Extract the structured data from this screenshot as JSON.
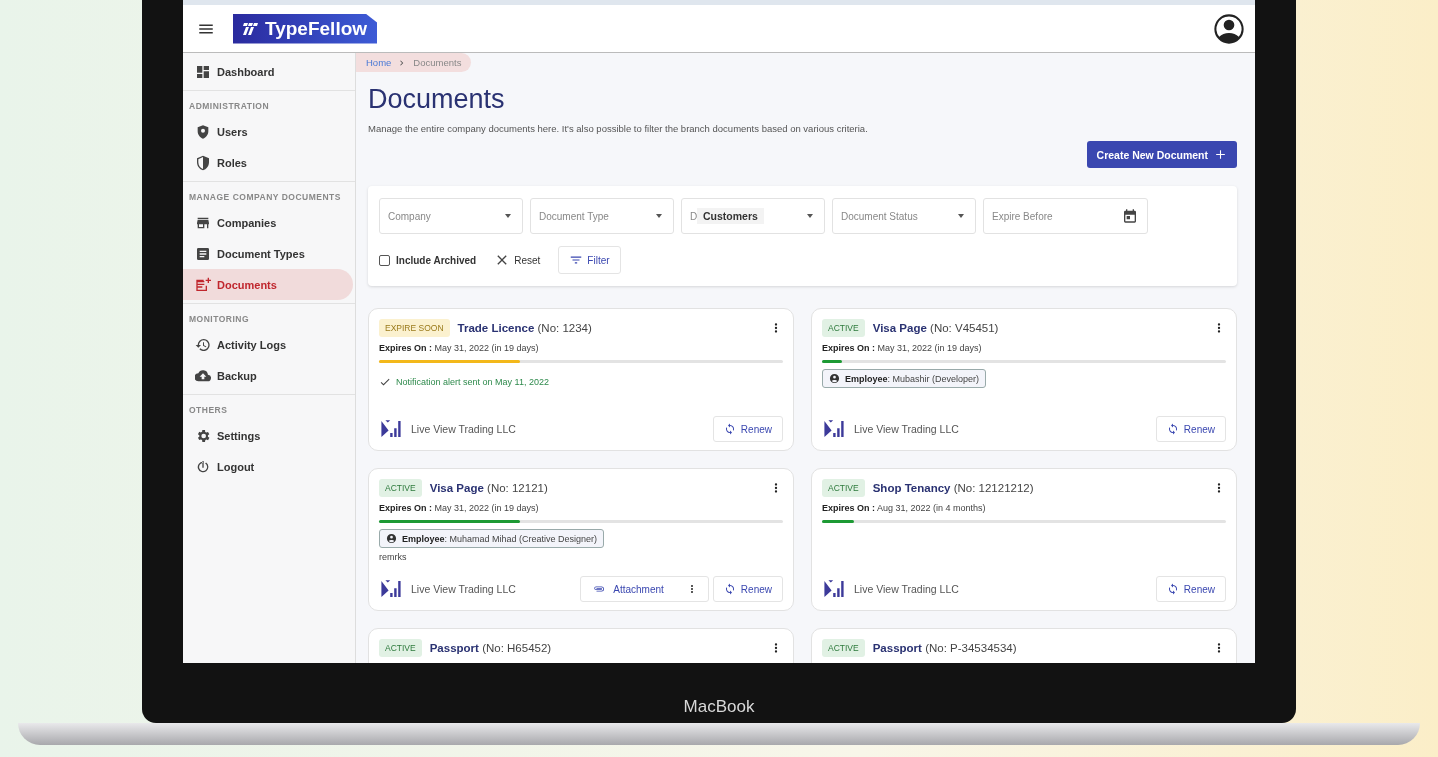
{
  "device_label": "MacBook",
  "app_bar": {
    "brand": "TypeFellow"
  },
  "sidebar": {
    "items": [
      {
        "kind": "item",
        "label": "Dashboard",
        "selected": false
      },
      {
        "kind": "header",
        "label": "ADMINISTRATION"
      },
      {
        "kind": "item",
        "label": "Users",
        "selected": false
      },
      {
        "kind": "item",
        "label": "Roles",
        "selected": false
      },
      {
        "kind": "header",
        "label": "MANAGE COMPANY DOCUMENTS"
      },
      {
        "kind": "item",
        "label": "Companies",
        "selected": false
      },
      {
        "kind": "item",
        "label": "Document Types",
        "selected": false
      },
      {
        "kind": "item",
        "label": "Documents",
        "selected": true
      },
      {
        "kind": "header",
        "label": "MONITORING"
      },
      {
        "kind": "item",
        "label": "Activity Logs",
        "selected": false
      },
      {
        "kind": "item",
        "label": "Backup",
        "selected": false
      },
      {
        "kind": "header",
        "label": "OTHERS"
      },
      {
        "kind": "item",
        "label": "Settings",
        "selected": false
      },
      {
        "kind": "item",
        "label": "Logout",
        "selected": false
      }
    ]
  },
  "breadcrumb": [
    "Home",
    "Documents"
  ],
  "page": {
    "title": "Documents",
    "description": "Manage the entire company documents here. It's also possible to filter the branch documents based on various criteria.",
    "create_button": "Create New Document"
  },
  "filters": {
    "fields": [
      {
        "kind": "select",
        "placeholder": "Company"
      },
      {
        "kind": "select",
        "placeholder": "Document Type"
      },
      {
        "kind": "select",
        "placeholder": "D",
        "overlay": "Customers"
      },
      {
        "kind": "select",
        "placeholder": "Document Status"
      },
      {
        "kind": "date",
        "placeholder": "Expire Before"
      }
    ],
    "include_archived": {
      "label": "Include Archived",
      "checked": false
    },
    "reset": "Reset",
    "filter": "Filter"
  },
  "documents": [
    {
      "kind": "expire_soon",
      "status_label": "EXPIRE SOON",
      "title": "Trade Licence",
      "number": "(No: 1234)",
      "expires_label": "Expires On :",
      "expires_value": "May 31, 2022 (in 19 days)",
      "level": 0.35,
      "notification": "Notification alert sent on May 11, 2022",
      "company": "Live View Trading LLC",
      "renew": "Renew"
    },
    {
      "kind": "active",
      "status_label": "ACTIVE",
      "title": "Visa Page",
      "number": "(No: V45451)",
      "expires_label": "Expires On :",
      "expires_value": "May 31, 2022 (in 19 days)",
      "level": 0.05,
      "employee": {
        "label": "Employee",
        "value": ": Mubashir (Developer)"
      },
      "company": "Live View Trading LLC",
      "renew": "Renew"
    },
    {
      "kind": "active",
      "status_label": "ACTIVE",
      "title": "Visa Page",
      "number": "(No: 12121)",
      "expires_label": "Expires On :",
      "expires_value": "May 31, 2022 (in 19 days)",
      "level": 0.35,
      "employee": {
        "label": "Employee",
        "value": ": Muhamad Mihad (Creative Designer)"
      },
      "remarks": "remrks",
      "company": "Live View Trading LLC",
      "attachment": "Attachment",
      "renew": "Renew"
    },
    {
      "kind": "active",
      "status_label": "ACTIVE",
      "title": "Shop Tenancy",
      "number": "(No: 12121212)",
      "expires_label": "Expires On :",
      "expires_value": "Aug 31, 2022 (in 4 months)",
      "level": 0.08,
      "company": "Live View Trading LLC",
      "renew": "Renew"
    },
    {
      "kind": "active",
      "status_label": "ACTIVE",
      "title": "Passport",
      "number": "(No: H65452)"
    },
    {
      "kind": "active",
      "status_label": "ACTIVE",
      "title": "Passport",
      "number": "(No: P-34534534)"
    }
  ]
}
